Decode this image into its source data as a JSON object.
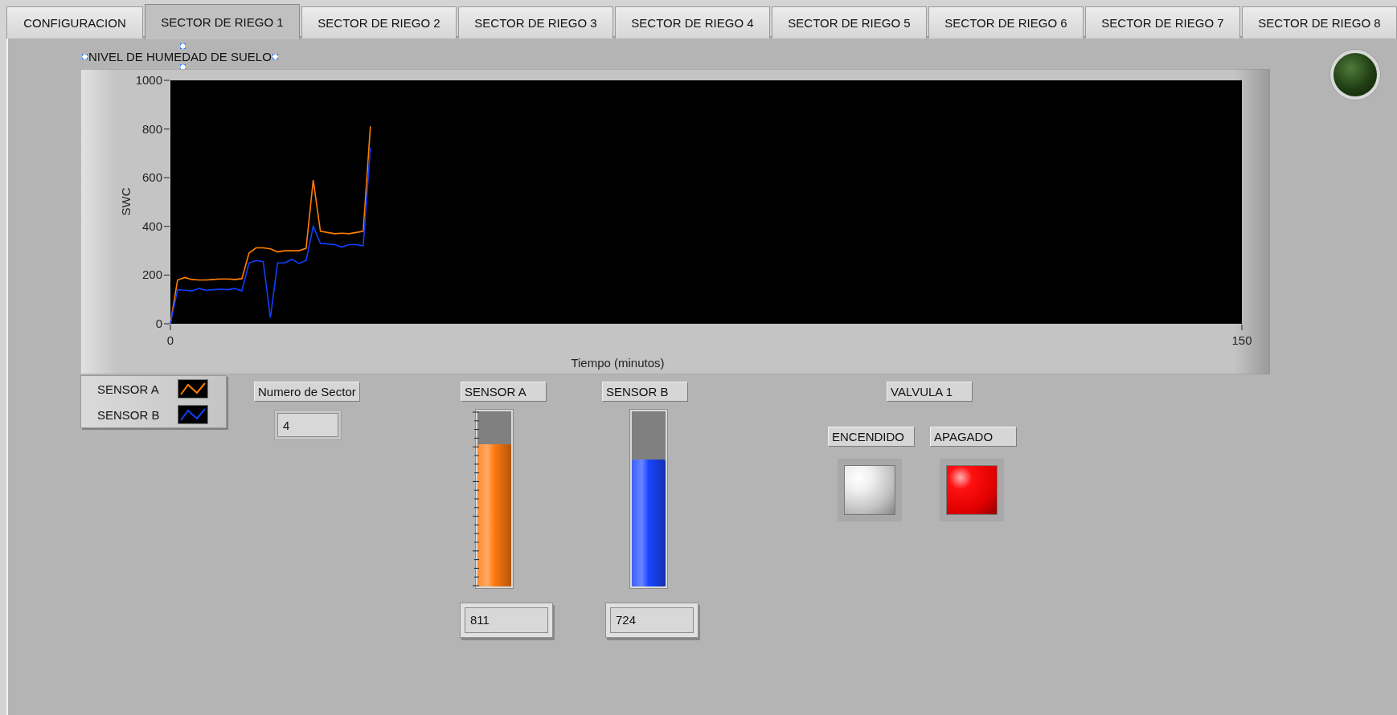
{
  "tabs": [
    {
      "label": "CONFIGURACION",
      "selected": false
    },
    {
      "label": "SECTOR DE RIEGO 1",
      "selected": true
    },
    {
      "label": "SECTOR DE RIEGO 2",
      "selected": false
    },
    {
      "label": "SECTOR DE RIEGO 3",
      "selected": false
    },
    {
      "label": "SECTOR DE RIEGO 4",
      "selected": false
    },
    {
      "label": "SECTOR DE RIEGO 5",
      "selected": false
    },
    {
      "label": "SECTOR DE RIEGO 6",
      "selected": false
    },
    {
      "label": "SECTOR DE RIEGO 7",
      "selected": false
    },
    {
      "label": "SECTOR DE RIEGO 8",
      "selected": false
    }
  ],
  "graph": {
    "label": "NIVEL DE HUMEDAD DE SUELO",
    "chart_data": {
      "type": "line",
      "xlabel": "Tiempo (minutos)",
      "ylabel": "SWC",
      "xlim": [
        0,
        150
      ],
      "ylim": [
        0,
        1000
      ],
      "xticks": [
        0,
        150
      ],
      "yticks": [
        0,
        200,
        400,
        600,
        800,
        1000
      ],
      "x": [
        0,
        1,
        2,
        3,
        4,
        5,
        6,
        7,
        8,
        9,
        10,
        11,
        12,
        13,
        14,
        15,
        16,
        17,
        18,
        19,
        20,
        21,
        22,
        23,
        24,
        25,
        26,
        27,
        28
      ],
      "series": [
        {
          "name": "SENSOR A",
          "color": "#ff7f00",
          "values": [
            0,
            180,
            190,
            182,
            180,
            180,
            182,
            184,
            184,
            182,
            185,
            290,
            312,
            312,
            308,
            295,
            300,
            300,
            300,
            310,
            590,
            380,
            375,
            370,
            372,
            370,
            375,
            380,
            811
          ]
        },
        {
          "name": "SENSOR B",
          "color": "#1040ff",
          "values": [
            0,
            140,
            138,
            135,
            145,
            138,
            140,
            142,
            140,
            145,
            135,
            250,
            260,
            255,
            25,
            250,
            250,
            265,
            248,
            260,
            400,
            330,
            328,
            325,
            315,
            325,
            325,
            320,
            724
          ]
        }
      ]
    },
    "legend": {
      "kind": "plot-legend"
    }
  },
  "indicator": {
    "on": false
  },
  "sector_number": {
    "label": "Numero de Sector",
    "value": "4"
  },
  "tanks": [
    {
      "label": "SENSOR A",
      "level": 0.811,
      "reading": "811",
      "color": "#ff7a10"
    },
    {
      "label": "SENSOR B",
      "level": 0.724,
      "reading": "724",
      "color": "#1a44ff"
    }
  ],
  "valve": {
    "label": "VALVULA 1",
    "lights": [
      {
        "label": "ENCENDIDO",
        "on": false
      },
      {
        "label": "APAGADO",
        "on": true
      }
    ]
  }
}
